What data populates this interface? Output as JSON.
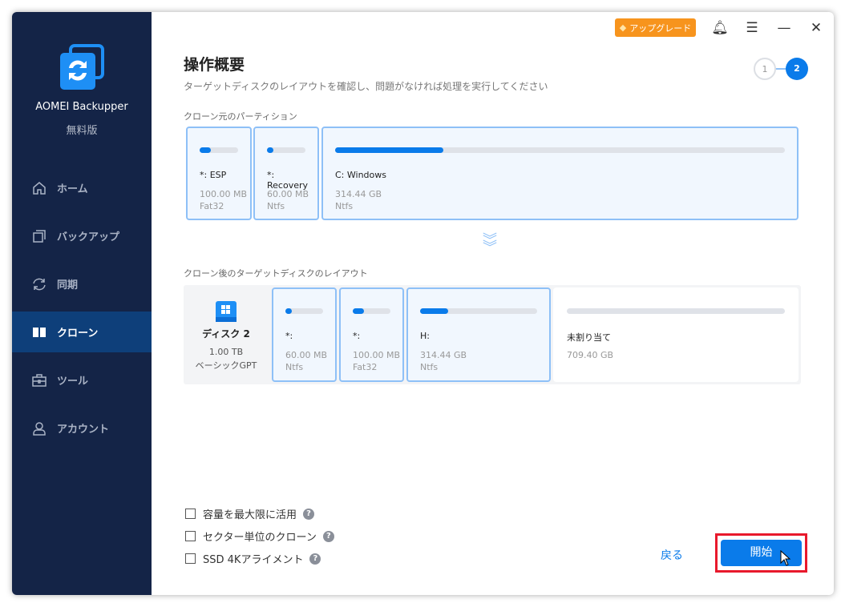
{
  "app": {
    "name": "AOMEI Backupper",
    "edition": "無料版"
  },
  "sidebar": {
    "items": [
      {
        "label": "ホーム"
      },
      {
        "label": "バックアップ"
      },
      {
        "label": "同期"
      },
      {
        "label": "クローン"
      },
      {
        "label": "ツール"
      },
      {
        "label": "アカウント"
      }
    ]
  },
  "toolbar": {
    "upgrade": "アップグレード"
  },
  "header": {
    "title": "操作概要",
    "subtitle": "ターゲットディスクのレイアウトを確認し、問題がなければ処理を実行してください",
    "steps": [
      "1",
      "2"
    ]
  },
  "source": {
    "label": "クローン元のパーティション",
    "partitions": [
      {
        "name": "*: ESP",
        "size": "100.00 MB",
        "fs": "Fat32",
        "used": 0.3
      },
      {
        "name": "*: Recovery",
        "size": "60.00 MB",
        "fs": "Ntfs",
        "used": 0.1
      },
      {
        "name": "C: Windows",
        "size": "314.44 GB",
        "fs": "Ntfs",
        "used": 0.24
      }
    ]
  },
  "target": {
    "label": "クローン後のターゲットディスクのレイアウト",
    "disk": {
      "name": "ディスク 2",
      "size": "1.00 TB",
      "type": "ベーシックGPT"
    },
    "partitions": [
      {
        "name": "*:",
        "size": "60.00 MB",
        "fs": "Ntfs",
        "used": 0.08
      },
      {
        "name": "*:",
        "size": "100.00 MB",
        "fs": "Fat32",
        "used": 0.3
      },
      {
        "name": "H:",
        "size": "314.44 GB",
        "fs": "Ntfs",
        "used": 0.24
      },
      {
        "name": "未割り当て",
        "size": "709.40 GB",
        "fs": "",
        "used": 0
      }
    ]
  },
  "options": [
    {
      "label": "容量を最大限に活用"
    },
    {
      "label": "セクター単位のクローン"
    },
    {
      "label": "SSD 4Kアライメント"
    }
  ],
  "buttons": {
    "back": "戻る",
    "start": "開始"
  },
  "colors": {
    "accent": "#0a7bea",
    "sidebar": "#142447",
    "highlight": "#e8192c"
  }
}
